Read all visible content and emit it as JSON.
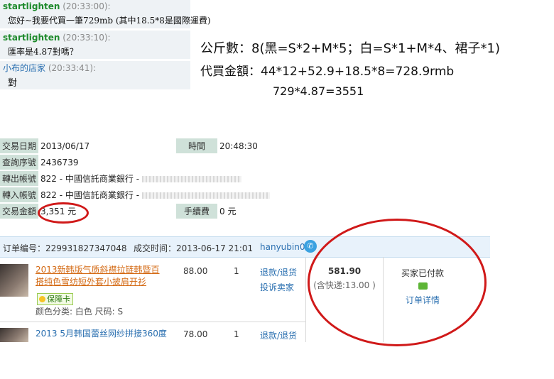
{
  "chat": {
    "messages": [
      {
        "sender": "startlighten",
        "time": "(20:33:00):",
        "text": "您好~我要代買一筆729mb (其中18.5*8是國際運費)"
      },
      {
        "sender": "startlighten",
        "time": "(20:33:10):",
        "text": "匯率是4.87對嗎？"
      },
      {
        "sender": "小布的店家",
        "time": "(20:33:41):",
        "text": "對"
      }
    ]
  },
  "note": {
    "line1": "公斤數：8(黑=S*2+M*5；白=S*1+M*4、裙子*1)",
    "line2": "代買金額：44*12+52.9+18.5*8=728.9rmb",
    "line3": "729*4.87=3551"
  },
  "bank": {
    "date_label": "交易日期",
    "date": "2013/06/17",
    "time_label": "時間",
    "time": "20:48:30",
    "serial_label": "查詢序號",
    "serial": "2436739",
    "out_label": "轉出帳號",
    "out_value": "822 - 中國信託商業銀行 -",
    "in_label": "轉入帳號",
    "in_value": "822 - 中國信託商業銀行 -",
    "amount_label": "交易金額",
    "amount": "3,351 元",
    "fee_label": "手續費",
    "fee": "0 元"
  },
  "order": {
    "number": "订单编号：229931827347048",
    "deal_time": "成交时间：2013-06-17 21:01",
    "buyer": "hanyubin0",
    "items": [
      {
        "title_line1": "2013新韩版气质斜襟拉链韩暨百",
        "title_line2": "搭纯色雪纺短外套小披肩开衫",
        "price": "88.00",
        "qty": "1",
        "badge": "保障卡",
        "attr": "颜色分类: 白色  尺码: S",
        "refund": "退款/退货",
        "complain": "投诉卖家"
      },
      {
        "title_line1": "2013 5月韩国蕾丝网纱拼接360度",
        "price": "78.00",
        "qty": "1",
        "refund": "退款/退货"
      }
    ],
    "total": "581.90",
    "shipping": "(含快递:13.00 )",
    "status": "买家已付款",
    "detail": "订单详情"
  },
  "colors": {
    "accent_red": "#d01919",
    "label_bg": "#cfe1d9",
    "link": "#2a6fb0",
    "orange_link": "#d46a14"
  }
}
